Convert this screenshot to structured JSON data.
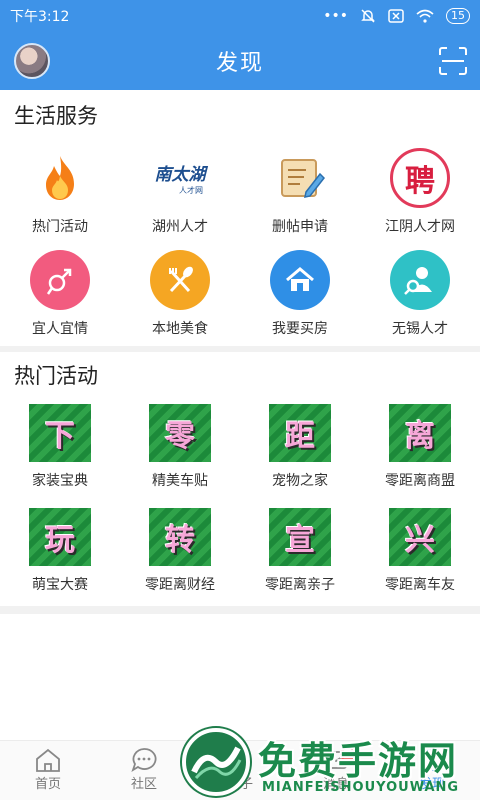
{
  "status": {
    "time": "下午3:12",
    "battery": "15"
  },
  "header": {
    "title": "发现"
  },
  "life_services": {
    "title": "生活服务",
    "items": [
      {
        "label": "热门活动",
        "icon": "flame-icon"
      },
      {
        "label": "湖州人才",
        "icon": "huzhou-talent-logo",
        "logo_text": "南太湖",
        "logo_sub": "人才网"
      },
      {
        "label": "删帖申请",
        "icon": "scroll-icon"
      },
      {
        "label": "江阴人才网",
        "icon": "recruit-icon",
        "logo_text": "聘"
      },
      {
        "label": "宜人宜情",
        "icon": "gender-icon",
        "color": "#f25b7f"
      },
      {
        "label": "本地美食",
        "icon": "fork-spoon-icon",
        "color": "#f5a623"
      },
      {
        "label": "我要买房",
        "icon": "house-icon",
        "color": "#2f8fe6"
      },
      {
        "label": "无锡人才",
        "icon": "person-search-icon",
        "color": "#2fc1c6"
      }
    ]
  },
  "hot_activities": {
    "title": "热门活动",
    "items": [
      {
        "label": "家装宝典",
        "tile_char": "下"
      },
      {
        "label": "精美车贴",
        "tile_char": "零"
      },
      {
        "label": "宠物之家",
        "tile_char": "距"
      },
      {
        "label": "零距离商盟",
        "tile_char": "离"
      },
      {
        "label": "萌宝大赛",
        "tile_char": "玩"
      },
      {
        "label": "零距离财经",
        "tile_char": "转"
      },
      {
        "label": "零距离亲子",
        "tile_char": "宣"
      },
      {
        "label": "零距离车友",
        "tile_char": "兴"
      }
    ]
  },
  "tabbar": {
    "tabs": [
      {
        "label": "首页"
      },
      {
        "label": "社区"
      },
      {
        "label": "圈子"
      },
      {
        "label": "消息",
        "badge": "3"
      },
      {
        "label": "发现"
      }
    ]
  },
  "watermark": {
    "title": "免费手游网",
    "subtitle": "MIANFEISHOUYOUWANG"
  }
}
